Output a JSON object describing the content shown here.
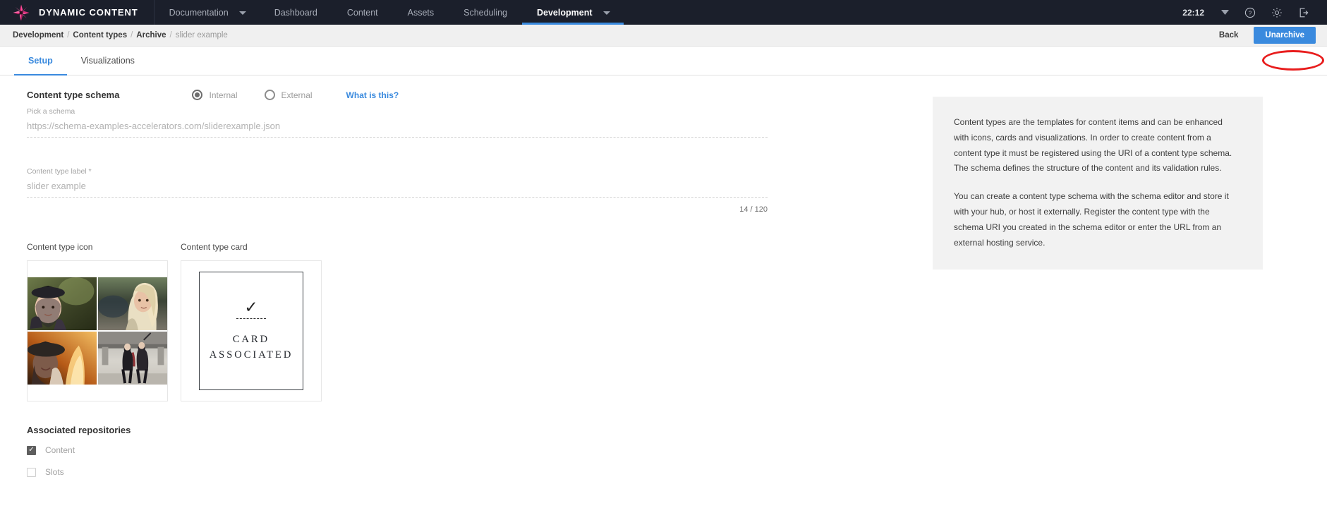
{
  "topnav": {
    "brand": "DYNAMIC CONTENT",
    "logo_icon": "star-burst-logo",
    "items": [
      {
        "label": "Documentation",
        "caret": true,
        "active": false
      },
      {
        "label": "Dashboard",
        "caret": false,
        "active": false
      },
      {
        "label": "Content",
        "caret": false,
        "active": false
      },
      {
        "label": "Assets",
        "caret": false,
        "active": false
      },
      {
        "label": "Scheduling",
        "caret": false,
        "active": false
      },
      {
        "label": "Development",
        "caret": true,
        "active": true
      }
    ],
    "time": "22:12",
    "icons": [
      "chevron-down-icon",
      "help-icon",
      "gear-icon",
      "logout-icon"
    ],
    "accent": "#3a8ade",
    "background": "#1b1f2b"
  },
  "breadcrumb": {
    "items": [
      "Development",
      "Content types",
      "Archive",
      "slider example"
    ],
    "separator": "/",
    "back_label": "Back",
    "unarchive_label": "Unarchive",
    "annotation_color": "#e81d1d"
  },
  "tabs": [
    {
      "label": "Setup",
      "active": true
    },
    {
      "label": "Visualizations",
      "active": false
    }
  ],
  "schema": {
    "section_title": "Content type schema",
    "radios": [
      {
        "label": "Internal",
        "checked": true
      },
      {
        "label": "External",
        "checked": false
      }
    ],
    "help_link": "What is this?",
    "pick_label": "Pick a schema",
    "pick_value": "https://schema-examples-accelerators.com/sliderexample.json"
  },
  "label_field": {
    "label": "Content type label *",
    "value": "slider example",
    "counter": "14 / 120"
  },
  "media": {
    "icon_label": "Content type icon",
    "card_label": "Content type card",
    "icon_alt": "collage-of-four-portrait-photos",
    "card_check_glyph": "✓",
    "card_line1": "CARD",
    "card_line2": "ASSOCIATED"
  },
  "repositories": {
    "title": "Associated repositories",
    "items": [
      {
        "label": "Content",
        "checked": true
      },
      {
        "label": "Slots",
        "checked": false
      }
    ]
  },
  "info_panel": {
    "paragraphs": [
      "Content types are the templates for content items and can be enhanced with icons, cards and visualizations. In order to create content from a content type it must be registered using the URI of a content type schema. The schema defines the structure of the content and its validation rules.",
      "You can create a content type schema with the schema editor and store it with your hub, or host it externally. Register the content type with the schema URI you created in the schema editor or enter the URL from an external hosting service."
    ]
  }
}
